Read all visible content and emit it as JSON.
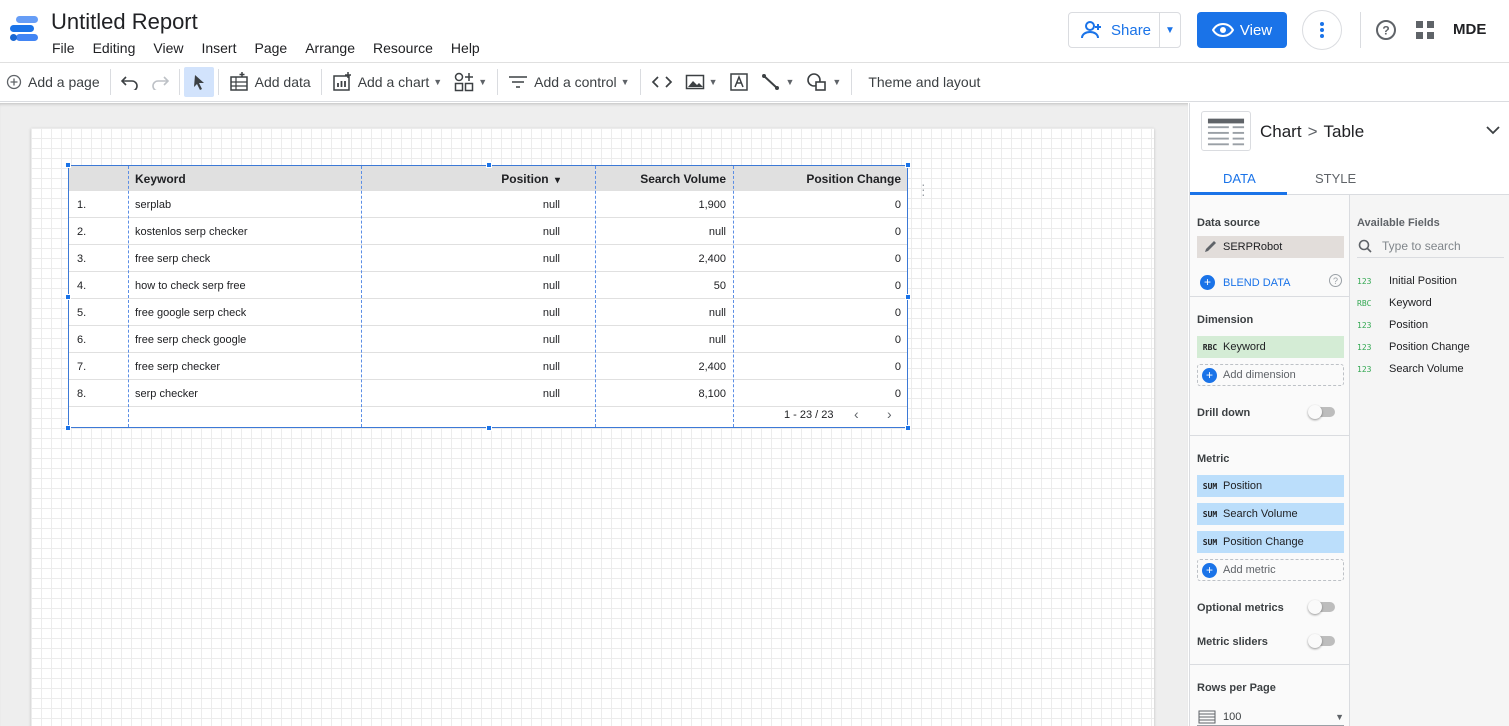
{
  "app": {
    "title": "Untitled Report",
    "user": "MDE"
  },
  "menu": [
    "File",
    "Editing",
    "View",
    "Insert",
    "Page",
    "Arrange",
    "Resource",
    "Help"
  ],
  "header": {
    "share_label": "Share",
    "view_label": "View"
  },
  "toolbar": {
    "add_page": "Add a page",
    "add_data": "Add data",
    "add_chart": "Add a chart",
    "add_control": "Add a control",
    "theme": "Theme and layout"
  },
  "table": {
    "headers": [
      "Keyword",
      "Position",
      "Search Volume",
      "Position Change"
    ],
    "sort_indicator": "▾",
    "rows": [
      {
        "n": "1.",
        "keyword": "serplab",
        "position": "null",
        "volume": "1,900",
        "change": "0"
      },
      {
        "n": "2.",
        "keyword": "kostenlos serp checker",
        "position": "null",
        "volume": "null",
        "change": "0"
      },
      {
        "n": "3.",
        "keyword": "free serp check",
        "position": "null",
        "volume": "2,400",
        "change": "0"
      },
      {
        "n": "4.",
        "keyword": "how to check serp free",
        "position": "null",
        "volume": "50",
        "change": "0"
      },
      {
        "n": "5.",
        "keyword": "free google serp check",
        "position": "null",
        "volume": "null",
        "change": "0"
      },
      {
        "n": "6.",
        "keyword": "free serp check google",
        "position": "null",
        "volume": "null",
        "change": "0"
      },
      {
        "n": "7.",
        "keyword": "free serp checker",
        "position": "null",
        "volume": "2,400",
        "change": "0"
      },
      {
        "n": "8.",
        "keyword": "serp checker",
        "position": "null",
        "volume": "8,100",
        "change": "0"
      }
    ],
    "pagination": "1 - 23 / 23"
  },
  "panel": {
    "crumb_chart": "Chart",
    "crumb_type": "Table",
    "tab_data": "DATA",
    "tab_style": "STYLE",
    "data_source_label": "Data source",
    "data_source": "SERPRobot",
    "blend_data": "BLEND DATA",
    "dimension_label": "Dimension",
    "dimension": {
      "type": "RBC",
      "name": "Keyword"
    },
    "add_dimension": "Add dimension",
    "drill_down": "Drill down",
    "metric_label": "Metric",
    "metrics": [
      {
        "type": "SUM",
        "name": "Position"
      },
      {
        "type": "SUM",
        "name": "Search Volume"
      },
      {
        "type": "SUM",
        "name": "Position Change"
      }
    ],
    "add_metric": "Add metric",
    "optional_metrics": "Optional metrics",
    "metric_sliders": "Metric sliders",
    "rows_per_page_label": "Rows per Page",
    "rows_per_page": "100",
    "available_label": "Available Fields",
    "search_placeholder": "Type to search",
    "fields": [
      {
        "type": "123",
        "name": "Initial Position"
      },
      {
        "type": "RBC",
        "name": "Keyword"
      },
      {
        "type": "123",
        "name": "Position"
      },
      {
        "type": "123",
        "name": "Position Change"
      },
      {
        "type": "123",
        "name": "Search Volume"
      }
    ]
  },
  "colors": {
    "accent": "#1a73e8",
    "dimension": "#d4ecd5",
    "metric": "#bbdefb"
  }
}
